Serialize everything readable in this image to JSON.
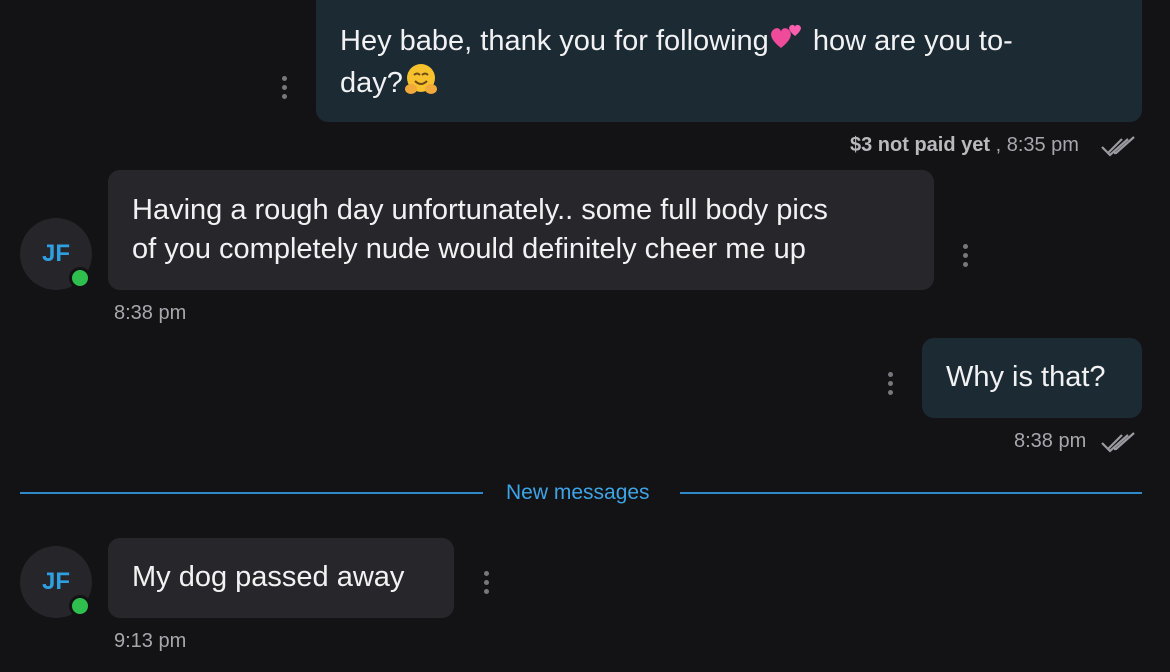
{
  "messages": {
    "m1": {
      "line1": "Hey babe, thank you for following",
      "line1_end": " how are you to-",
      "line2": "day?",
      "emoji_1": "two-hearts-icon",
      "emoji_2": "hugging-face-icon",
      "price": "$3 not paid yet",
      "time_sep": " , ",
      "time": "8:35 pm"
    },
    "m2": {
      "avatar": "JF",
      "line1": "Having a rough day unfortunately.. some full body pics",
      "line2": "of you completely nude would definitely cheer me up",
      "time": "8:38 pm"
    },
    "m3": {
      "text": "Why is that?",
      "time": "8:38 pm"
    },
    "divider": {
      "label": "New messages"
    },
    "m4": {
      "avatar": "JF",
      "text": "My dog passed away",
      "time": "9:13 pm"
    }
  },
  "colors": {
    "background": "#131316",
    "outgoing_bubble": "#1b2a33",
    "incoming_bubble": "#27272b",
    "accent": "#3da4e6",
    "online": "#2fbf4f"
  }
}
